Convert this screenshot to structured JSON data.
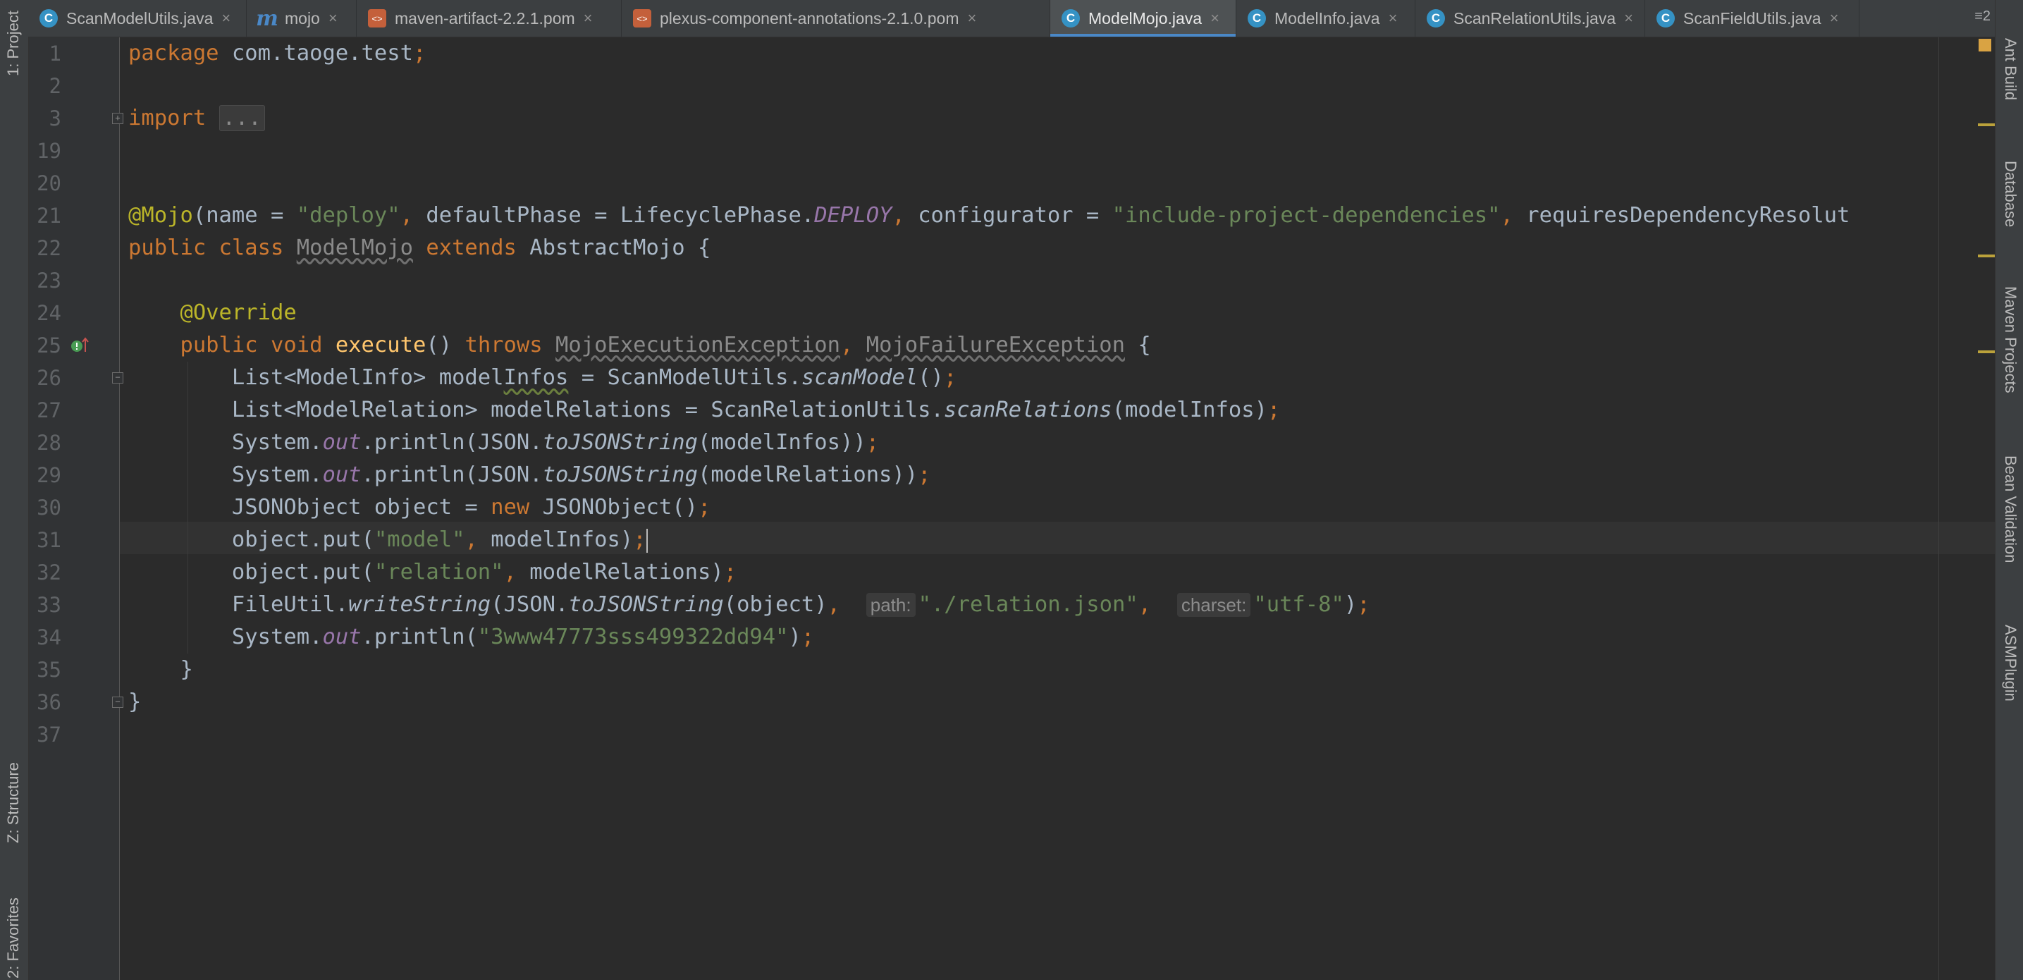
{
  "tabs": [
    {
      "label": "ScanModelUtils.java",
      "icon": "class-icon",
      "active": false
    },
    {
      "label": "mojo",
      "icon": "maven-icon",
      "active": false
    },
    {
      "label": "maven-artifact-2.2.1.pom",
      "icon": "pom-icon",
      "active": false
    },
    {
      "label": "plexus-component-annotations-2.1.0.pom",
      "icon": "pom-icon",
      "active": false
    },
    {
      "label": "ModelMojo.java",
      "icon": "class-icon",
      "active": true
    },
    {
      "label": "ModelInfo.java",
      "icon": "class-icon",
      "active": false
    },
    {
      "label": "ScanRelationUtils.java",
      "icon": "class-icon",
      "active": false
    },
    {
      "label": "ScanFieldUtils.java",
      "icon": "class-icon",
      "active": false
    }
  ],
  "tab_overflow": "≡2",
  "left_tools": [
    "1: Project",
    "Z: Structure",
    "2: Favorites"
  ],
  "right_tools": [
    "Ant Build",
    "Database",
    "Maven Projects",
    "Bean Validation",
    "ASMPlugin"
  ],
  "line_numbers": [
    "1",
    "2",
    "3",
    "19",
    "20",
    "21",
    "22",
    "23",
    "24",
    "25",
    "26",
    "27",
    "28",
    "29",
    "30",
    "31",
    "32",
    "33",
    "34",
    "35",
    "36",
    "37"
  ],
  "code": {
    "l1": {
      "kw": "package",
      "pkg": "com.taoge.test",
      "semi": ";"
    },
    "l3": {
      "kw": "import",
      "folded": "..."
    },
    "l21": {
      "ann": "@Mojo",
      "p1": "(name = ",
      "s1": "\"deploy\"",
      "c1": ",",
      "p2": " defaultPhase = LifecyclePhase.",
      "st1": "DEPLOY",
      "c2": ",",
      "p3": " configurator = ",
      "s2": "\"include-project-dependencies\"",
      "c3": ",",
      "p4": " requiresDependencyResolut"
    },
    "l22": {
      "kw1": "public class ",
      "cls": "ModelMojo",
      "kw2": " extends ",
      "base": "AbstractMojo {"
    },
    "l24": {
      "ann": "@Override"
    },
    "l25": {
      "kw1": "public void ",
      "fn": "execute",
      "p1": "() ",
      "kw2": "throws ",
      "ex1": "MojoExecutionException",
      "c1": ", ",
      "ex2": "MojoFailureException",
      "p2": " {"
    },
    "l26": {
      "p1": "List<ModelInfo> model",
      "w": "Infos",
      "p2": " = ScanModelUtils.",
      "im": "scanModel",
      "p3": "()",
      "semi": ";"
    },
    "l27": {
      "p1": "List<ModelRelation> modelRelations = ScanRelationUtils.",
      "im": "scanRelations",
      "p2": "(modelInfos)",
      "semi": ";"
    },
    "l28": {
      "p1": "System.",
      "st": "out",
      "p2": ".println(JSON.",
      "im": "toJSONString",
      "p3": "(modelInfos))",
      "semi": ";"
    },
    "l29": {
      "p1": "System.",
      "st": "out",
      "p2": ".println(JSON.",
      "im": "toJSONString",
      "p3": "(modelRelations))",
      "semi": ";"
    },
    "l30": {
      "p1": "JSONObject object = ",
      "kw": "new",
      "p2": " JSONObject()",
      "semi": ";"
    },
    "l31": {
      "p1": "object.put(",
      "s1": "\"model\"",
      "c1": ",",
      "p2": " modelInfos)",
      "semi": ";"
    },
    "l32": {
      "p1": "object.put(",
      "s1": "\"relation\"",
      "c1": ",",
      "p2": " modelRelations)",
      "semi": ";"
    },
    "l33": {
      "p1": "FileUtil.",
      "im": "writeString",
      "p2": "(JSON.",
      "im2": "toJSONString",
      "p3": "(object)",
      "c1": ",",
      "h1": "path:",
      "s1": "\"./relation.json\"",
      "c2": ",",
      "h2": "charset:",
      "s2": "\"utf-8\"",
      "p4": ")",
      "semi": ";"
    },
    "l34": {
      "p1": "System.",
      "st": "out",
      "p2": ".println(",
      "s1": "\"3www47773sss499322dd94\"",
      "p3": ")",
      "semi": ";"
    },
    "l35": {
      "p1": "}"
    },
    "l36": {
      "p1": "}"
    }
  },
  "colors": {
    "keyword": "#cc7832",
    "string": "#6a8759",
    "annotation": "#bbb529",
    "static": "#9876aa",
    "method": "#ffc66d",
    "text": "#a9b7c6",
    "background": "#2b2b2b"
  }
}
